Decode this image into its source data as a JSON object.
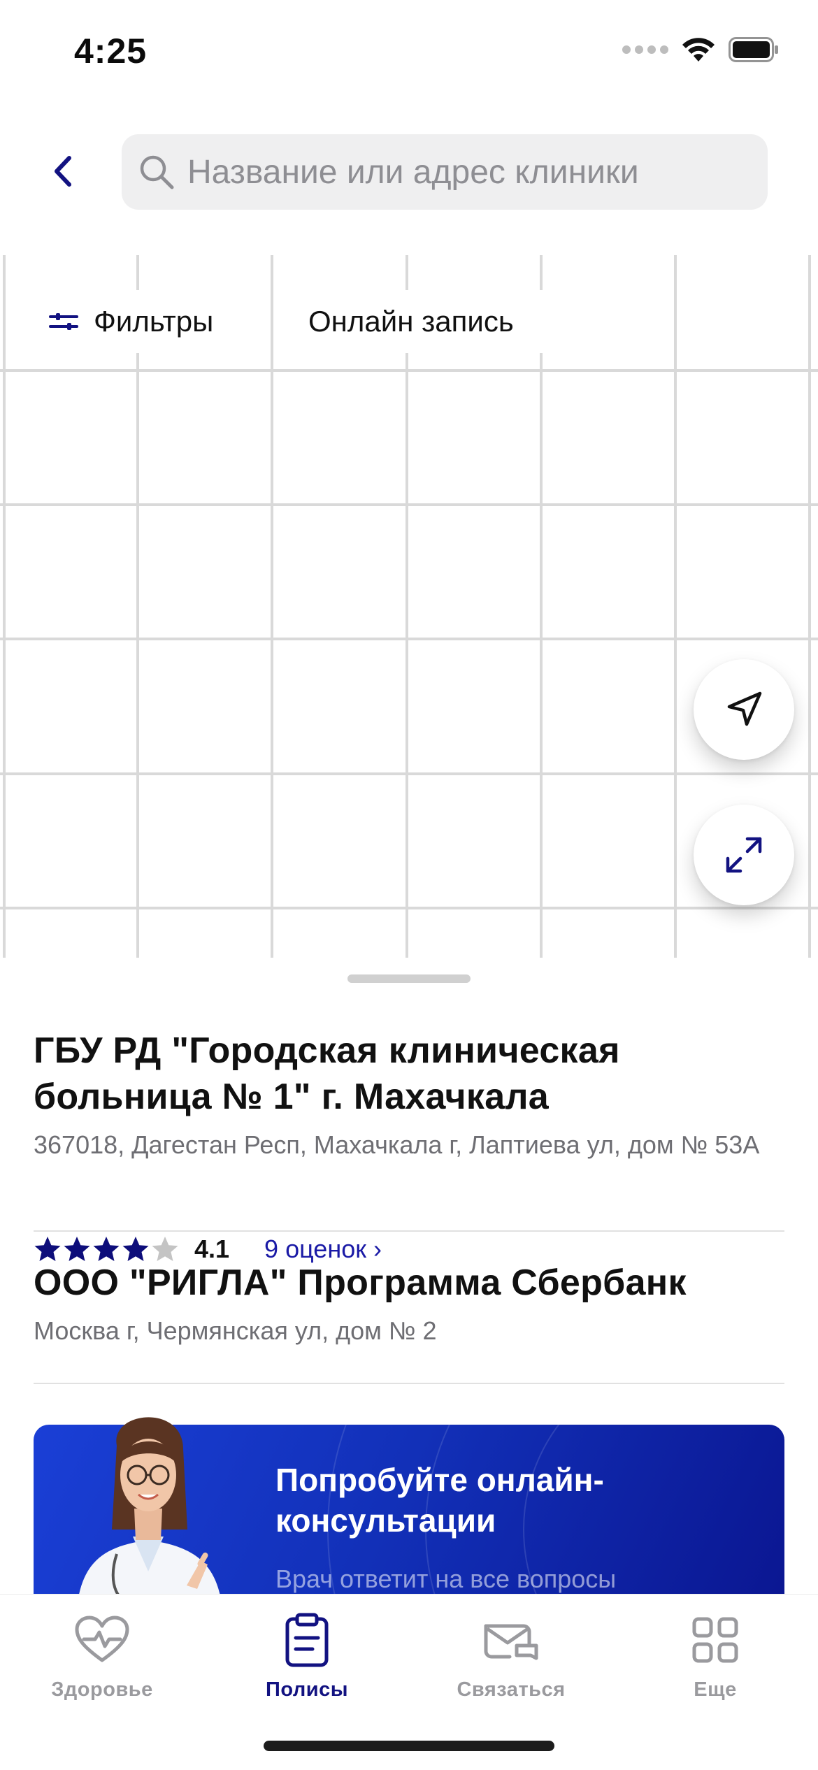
{
  "status_bar": {
    "time": "4:25"
  },
  "header": {
    "back_icon": "chevron-left-icon",
    "search": {
      "placeholder": "Название или адрес клиники",
      "value": ""
    }
  },
  "map": {
    "chips": {
      "filters_label": "Фильтры",
      "online_label": "Онлайн запись"
    },
    "locate_icon": "navigation-arrow-icon",
    "expand_icon": "expand-arrows-icon"
  },
  "clinics": [
    {
      "name": "ГБУ РД \"Городская клиническая больница № 1\" г. Махачкала",
      "address": "367018, Дагестан Респ, Махачкала г, Лаптиева ул, дом № 53А",
      "rating": "4.1",
      "rating_fraction": 0.82,
      "reviews": "9 оценок ›"
    },
    {
      "name": "ООО \"РИГЛА\" Программа Сбербанк",
      "address": "Москва г, Чермянская ул, дом № 2"
    }
  ],
  "promo": {
    "title": "Попробуйте онлайн-консультации",
    "subtitle": "Врач ответит на все вопросы"
  },
  "tab_bar": {
    "tabs": [
      {
        "label": "Здоровье",
        "icon": "heart-pulse-icon",
        "active": false
      },
      {
        "label": "Полисы",
        "icon": "clipboard-icon",
        "active": true
      },
      {
        "label": "Связаться",
        "icon": "envelope-chat-icon",
        "active": false
      },
      {
        "label": "Еще",
        "icon": "grid-icon",
        "active": false
      }
    ]
  },
  "colors": {
    "accent": "#121281",
    "star_filled": "#0d0d7a",
    "star_empty": "#c4c4c4",
    "link": "#1a1aa6",
    "promo_start": "#1a3fd6",
    "promo_end": "#0a148e",
    "inactive_tab": "#9a9a9e"
  }
}
